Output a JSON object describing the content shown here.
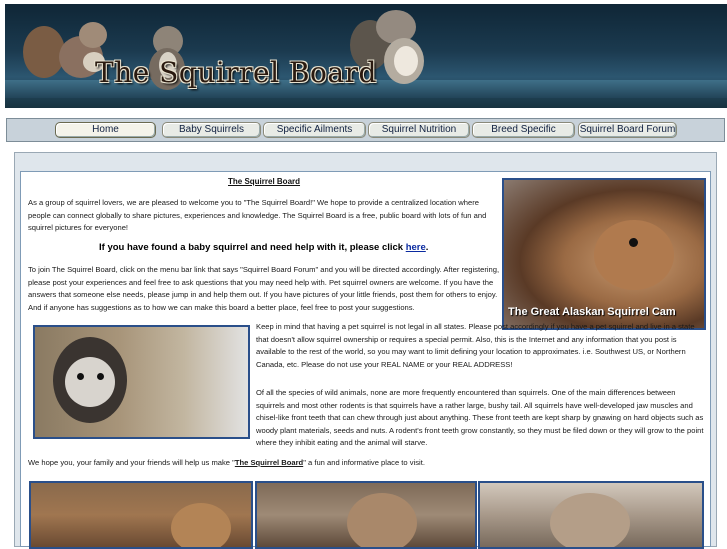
{
  "banner": {
    "title": "The Squirrel Board"
  },
  "nav": [
    {
      "label": "Home"
    },
    {
      "label": "Baby Squirrels"
    },
    {
      "label": "Specific Ailments"
    },
    {
      "label": "Squirrel Nutrition"
    },
    {
      "label": "Breed Specific"
    },
    {
      "label": "Squirrel Board Forum"
    }
  ],
  "content": {
    "heading": "The Squirrel Board",
    "intro": "As a group of squirrel lovers, we are pleased to welcome you to \"The Squirrel Board!\" We hope to provide a centralized location where people can connect globally to share pictures, experiences and knowledge. The Squirrel Board is a free, public board with lots of fun and squirrel pictures for everyone!",
    "baby_prefix": "If you have found a baby squirrel and need help with it, please click ",
    "baby_link": "here",
    "baby_suffix": ".",
    "join": "To join The Squirrel Board, click on the menu bar link that says \"Squirrel Board Forum\" and you will be directed accordingly.  After registering, please post your experiences and feel free to ask questions that you may need help with. Pet squirrel owners are welcome. If you have the answers that someone else needs, please jump in and help them out. If you have pictures of your little friends, post them for others to enjoy. And if anyone has suggestions as to how we can make this board a better place, feel free to post your suggestions.",
    "legal": "Keep in mind that having a pet squirrel is not legal in all states.  Please post accordingly if you have a pet squirrel and live in a state that doesn't allow squirrel ownership or requires a special permit. Also, this is the Internet and any information that you post is available to the rest of the world, so you may want to limit defining your location to approximates.  i.e. Southwest US, or Northern Canada, etc.  Please do not use your REAL NAME or your REAL ADDRESS!",
    "species": "Of all the species of wild animals, none are more frequently encountered than squirrels. One of the main differences between squirrels and most other rodents is that squirrels have a rather large, bushy tail. All squirrels have well-developed jaw muscles and chisel-like front teeth that can chew through just about anything. These front teeth are kept sharp by gnawing on hard objects such as woody plant materials, seeds and nuts. A rodent's front teeth grow constantly, so they must be filed down or they will grow to the point where they inhibit eating and the animal will starve.",
    "closing_prefix": "We hope you, your family and your friends will help us make \"",
    "closing_link": "The Squirrel Board",
    "closing_suffix": "\" a fun and informative place to visit.",
    "cam_label": "The Great Alaskan Squirrel Cam"
  }
}
